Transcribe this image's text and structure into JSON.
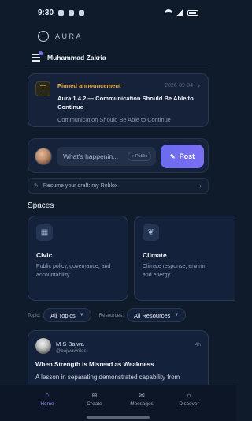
{
  "status_bar": {
    "time": "9:30"
  },
  "app": {
    "brand": "AURA"
  },
  "user": {
    "name": "Muhammad Zakria"
  },
  "announcement": {
    "label": "Pinned announcement",
    "date": "2026-09-04",
    "title": "Aura 1.4.2 — Communication Should Be Able to Continue",
    "subtitle": "Communication Should Be Able to Continue",
    "icon": "pin-icon",
    "accent": "#f0a93a"
  },
  "composer": {
    "placeholder": "What's happenin...",
    "visibility": "Public",
    "post_label": "Post",
    "accent": "#6a6cf0"
  },
  "draft": {
    "text": "Resume your draft: my Roblox"
  },
  "spaces": {
    "title": "Spaces",
    "items": [
      {
        "name": "Civic",
        "description_1": "Public policy, governance, and",
        "description_2": "accountability.",
        "icon": "building-icon"
      },
      {
        "name": "Climate",
        "description_1": "Climate response, environ",
        "description_2": "and energy.",
        "icon": "leaf-icon"
      }
    ]
  },
  "filters": {
    "topic_label": "Topic:",
    "topic_value": "All Topics",
    "resources_label": "Resources:",
    "resources_value": "All Resources"
  },
  "post": {
    "author": "M S Bajwa",
    "handle": "@bajwawrites",
    "time": "4h",
    "title": "When Strength Is Misread as Weakness",
    "excerpt": "A lesson in separating demonstrated capability from"
  },
  "bottom_nav": [
    {
      "label": "Home",
      "icon": "home-icon",
      "active": true
    },
    {
      "label": "Create",
      "icon": "plus-circle-icon",
      "active": false
    },
    {
      "label": "Messages",
      "icon": "mail-icon",
      "active": false
    },
    {
      "label": "Discover",
      "icon": "compass-icon",
      "active": false
    }
  ]
}
